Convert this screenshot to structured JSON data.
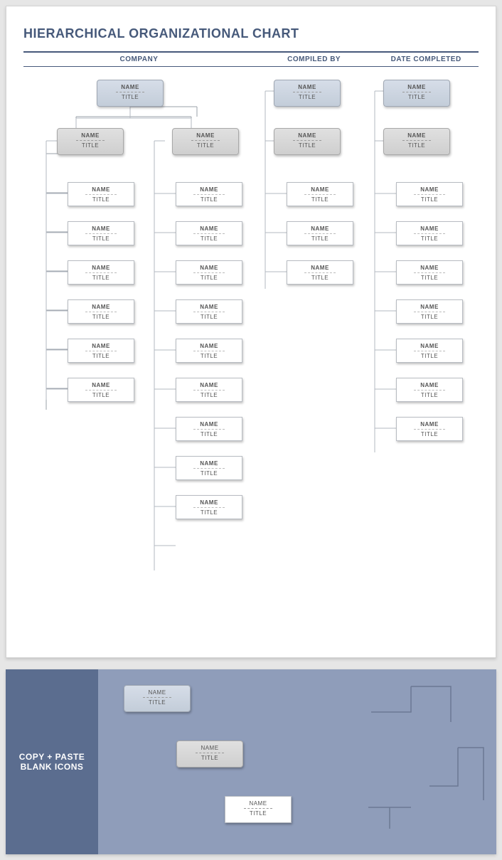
{
  "title": "HIERARCHICAL ORGANIZATIONAL CHART",
  "headers": {
    "company": "COMPANY",
    "compiled": "COMPILED BY",
    "date": "DATE COMPLETED"
  },
  "node": {
    "name": "NAME",
    "title": "TITLE"
  },
  "columns": {
    "A": {
      "top": {
        "type": "lvl1"
      },
      "leafCount": 0
    },
    "B": {
      "top": {
        "type": "lvl2"
      },
      "leafCount": 6
    },
    "C": {
      "top": {
        "type": "lvl2"
      },
      "leafCount": 9
    },
    "D": {
      "top": {
        "type": "lvl1"
      },
      "mid": {
        "type": "lvl2"
      },
      "leafCount": 3
    },
    "E": {
      "top": {
        "type": "lvl1"
      },
      "mid": {
        "type": "lvl2"
      },
      "leafCount": 7
    }
  },
  "panel": {
    "sideLabel": "COPY + PASTE BLANK ICONS",
    "samples": [
      "blue",
      "gray",
      "white"
    ]
  }
}
